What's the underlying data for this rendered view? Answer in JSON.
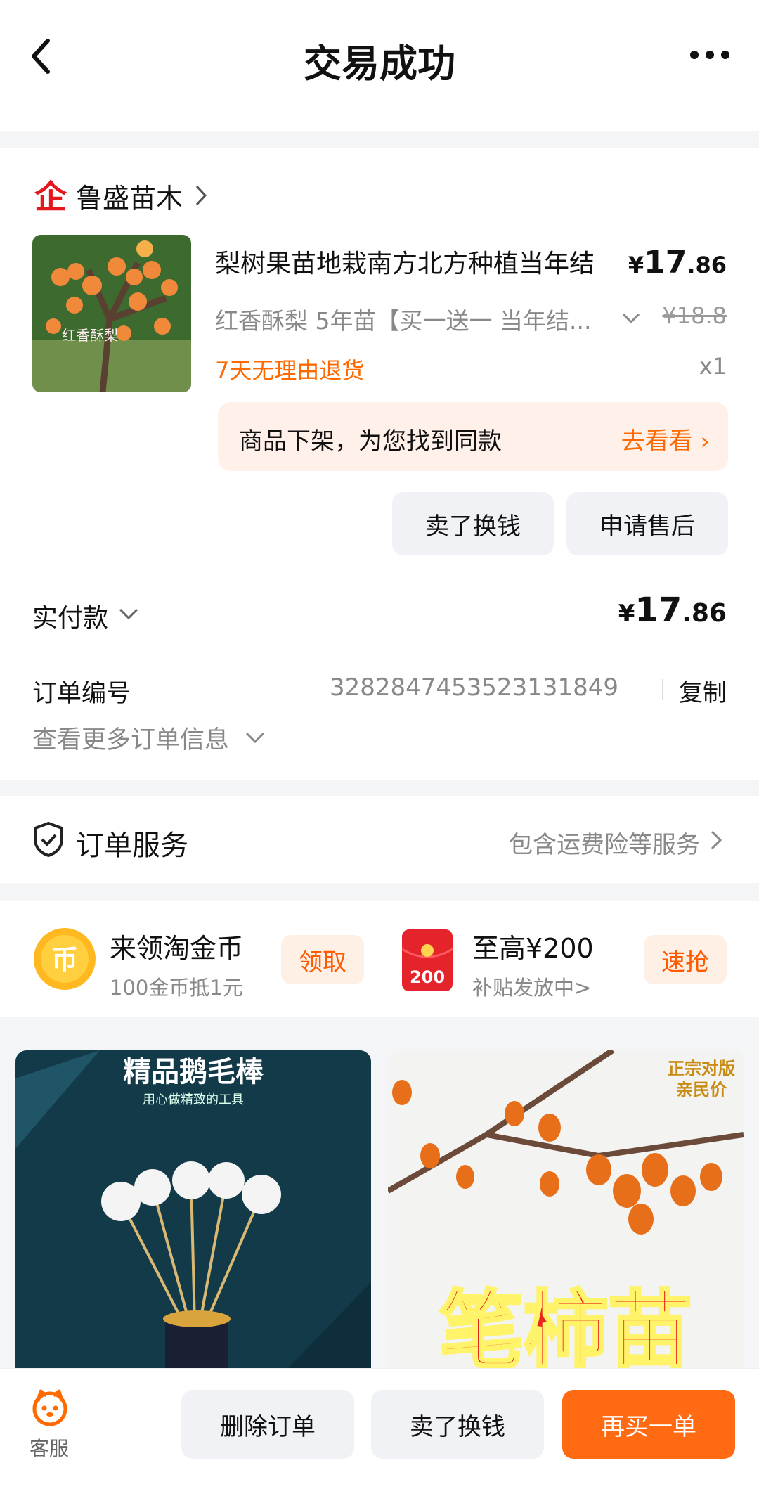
{
  "header": {
    "title": "交易成功"
  },
  "shop": {
    "logo_glyph": "企",
    "name": "鲁盛苗木"
  },
  "product": {
    "title": "梨树果苗地栽南方北方种植当年结",
    "image_overlay": "红香酥梨",
    "price_symbol": "¥",
    "price_int": "17",
    "price_dec": ".86",
    "sku": "红香酥梨 5年苗【买一送一 当年结...",
    "old_price": "¥18.8",
    "return_policy": "7天无理由退货",
    "quantity": "x1"
  },
  "notice": {
    "text": "商品下架，为您找到同款",
    "action": "去看看 ›"
  },
  "item_actions": {
    "sell": "卖了换钱",
    "after_sale": "申请售后"
  },
  "payment": {
    "label": "实付款",
    "symbol": "¥",
    "int": "17",
    "dec": ".86"
  },
  "order": {
    "number_label": "订单编号",
    "number": "3282847453523131849",
    "copy": "复制",
    "more_info": "查看更多订单信息"
  },
  "service": {
    "label": "订单服务",
    "desc": "包含运费险等服务"
  },
  "coupons": {
    "coin": {
      "title": "来领淘金币",
      "sub": "100金币抵1元",
      "button": "领取",
      "glyph": "币"
    },
    "red": {
      "title": "至高¥200",
      "sub": "补贴发放中>",
      "button": "速抢",
      "badge": "200"
    }
  },
  "recommend": [
    {
      "headline": "精品鹅毛棒",
      "subline": "用心做精致的工具"
    },
    {
      "headline": "笔柿苗",
      "tag_line1": "正宗对版",
      "tag_line2": "亲民价"
    }
  ],
  "bottom_bar": {
    "customer_service": "客服",
    "delete": "删除订单",
    "sell": "卖了换钱",
    "rebuy": "再买一单"
  },
  "colors": {
    "accent": "#ff6a00",
    "rebuy_bg": "#ff6a12",
    "notice_bg": "#fff0ea"
  }
}
